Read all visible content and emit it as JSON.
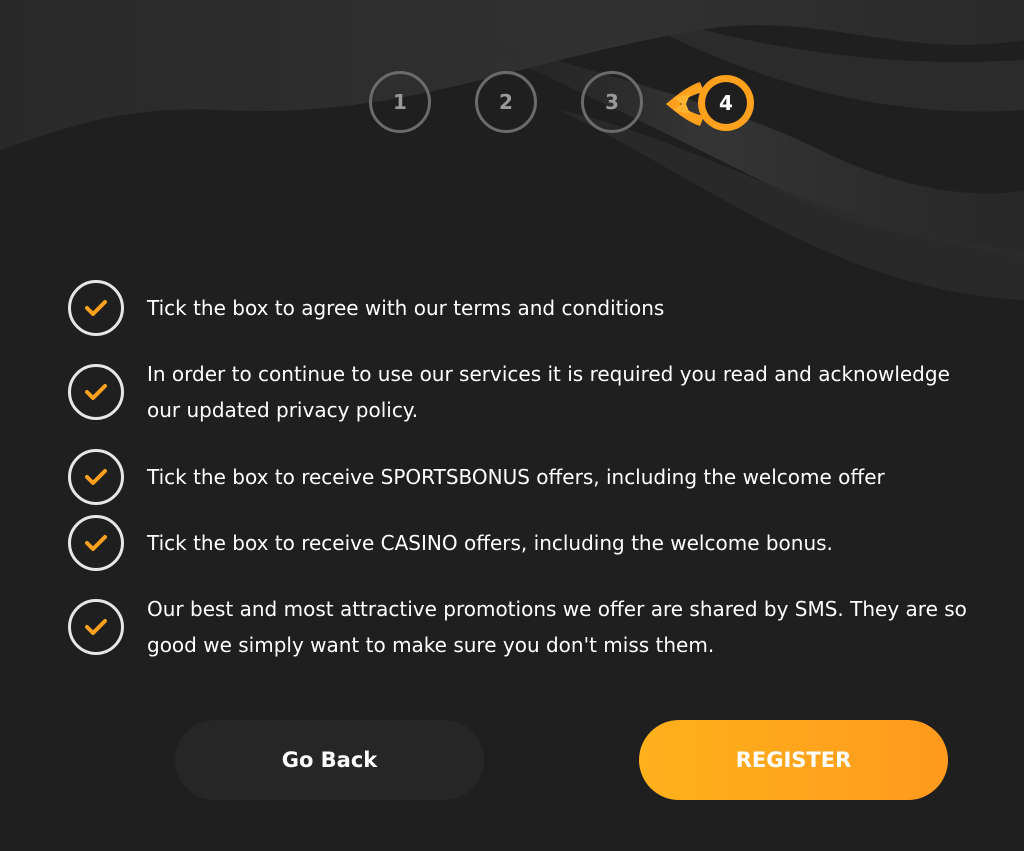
{
  "colors": {
    "background": "#1f1f1f",
    "accent": "#ffa11c",
    "step_inactive_border": "#6b6b6b",
    "check_border": "#e6e6e6",
    "button_secondary": "#262626"
  },
  "stepper": {
    "steps": [
      "1",
      "2",
      "3",
      "4"
    ],
    "active_step": "4"
  },
  "consents": [
    {
      "text": "Tick the box to agree with our terms and conditions",
      "checked": true,
      "icon": "checkmark-icon"
    },
    {
      "text": "In order to continue to use our services it is required you read and acknowledge our updated privacy policy.",
      "checked": true,
      "icon": "checkmark-icon"
    },
    {
      "text": "Tick the box to receive SPORTSBONUS offers, including the welcome offer",
      "checked": true,
      "icon": "checkmark-icon"
    },
    {
      "text": "Tick the box to receive CASINO offers, including the welcome bonus.",
      "checked": true,
      "icon": "checkmark-icon"
    },
    {
      "text": "Our best and most attractive promotions we offer are shared by SMS. They are so good we simply want to make sure you don't miss them.",
      "checked": true,
      "icon": "checkmark-icon"
    }
  ],
  "actions": {
    "back_label": "Go Back",
    "register_label": "REGISTER"
  }
}
